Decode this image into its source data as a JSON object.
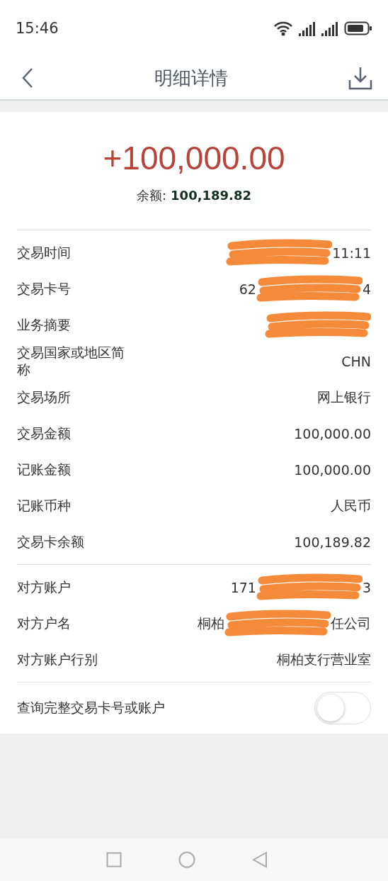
{
  "status_bar": {
    "time": "15:46"
  },
  "header": {
    "title": "明细详情"
  },
  "summary": {
    "amount": "+100,000.00",
    "balance_label": "余额:",
    "balance": "100,189.82"
  },
  "groups": [
    {
      "rows": [
        {
          "label": "交易时间",
          "value_parts": [
            {
              "kind": "scribble"
            },
            {
              "kind": "text",
              "text": "11:11"
            }
          ]
        },
        {
          "label": "交易卡号",
          "value_parts": [
            {
              "kind": "text",
              "text": "62"
            },
            {
              "kind": "scribble"
            },
            {
              "kind": "text",
              "text": "4"
            }
          ]
        },
        {
          "label": "业务摘要",
          "value_parts": [
            {
              "kind": "scribble"
            }
          ]
        },
        {
          "label": "交易国家或地区简称",
          "value_parts": [
            {
              "kind": "text",
              "text": "CHN"
            }
          ]
        },
        {
          "label": "交易场所",
          "value_parts": [
            {
              "kind": "text",
              "text": "网上银行"
            }
          ]
        },
        {
          "label": "交易金额",
          "value_parts": [
            {
              "kind": "text",
              "text": "100,000.00"
            }
          ]
        },
        {
          "label": "记账金额",
          "value_parts": [
            {
              "kind": "text",
              "text": "100,000.00"
            }
          ]
        },
        {
          "label": "记账币种",
          "value_parts": [
            {
              "kind": "text",
              "text": "人民币"
            }
          ]
        },
        {
          "label": "交易卡余额",
          "value_parts": [
            {
              "kind": "text",
              "text": "100,189.82"
            }
          ]
        }
      ]
    },
    {
      "rows": [
        {
          "label": "对方账户",
          "value_parts": [
            {
              "kind": "text",
              "text": "171"
            },
            {
              "kind": "scribble"
            },
            {
              "kind": "text",
              "text": "3"
            }
          ]
        },
        {
          "label": "对方户名",
          "value_parts": [
            {
              "kind": "text",
              "text": "桐柏"
            },
            {
              "kind": "scribble"
            },
            {
              "kind": "text",
              "text": "任公司"
            }
          ]
        },
        {
          "label": "对方账户行别",
          "value_parts": [
            {
              "kind": "text",
              "text": "桐柏支行营业室"
            }
          ]
        }
      ]
    }
  ],
  "toggle_row": {
    "label": "查询完整交易卡号或账户",
    "on": false
  }
}
